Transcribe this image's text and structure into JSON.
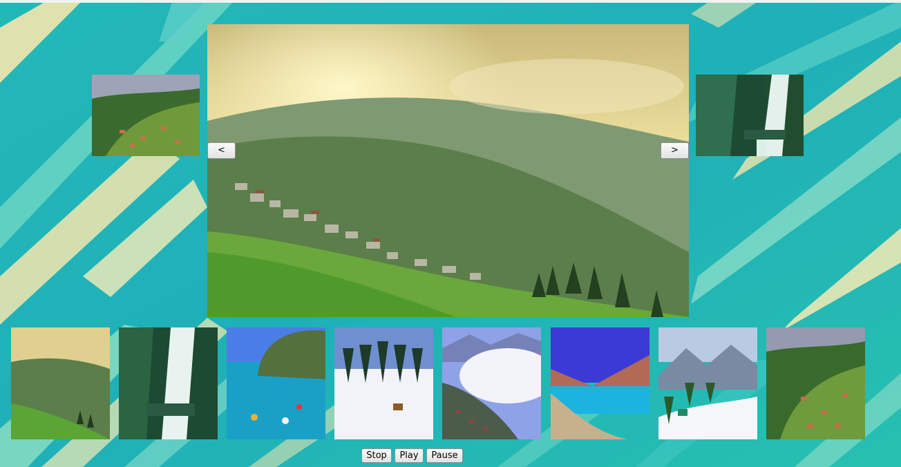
{
  "slider": {
    "prev_label": "<",
    "next_label": ">",
    "current_image": "darjeeling-tea-hills",
    "prev_image": "hillside-terraces",
    "next_image": "waterfall"
  },
  "thumbnails": [
    {
      "image": "darjeeling-tea-hills"
    },
    {
      "image": "waterfall"
    },
    {
      "image": "sea-snorkeling"
    },
    {
      "image": "snowy-pine-village"
    },
    {
      "image": "misty-hill-town"
    },
    {
      "image": "mountain-lake"
    },
    {
      "image": "snow-mountains"
    },
    {
      "image": "hillside-terraces"
    }
  ],
  "controls": {
    "stop_label": "Stop",
    "play_label": "Play",
    "pause_label": "Pause"
  },
  "colors": {
    "teal": "#1fb5b5",
    "light_teal": "#57d6c0",
    "cream": "#f6e9b0"
  }
}
